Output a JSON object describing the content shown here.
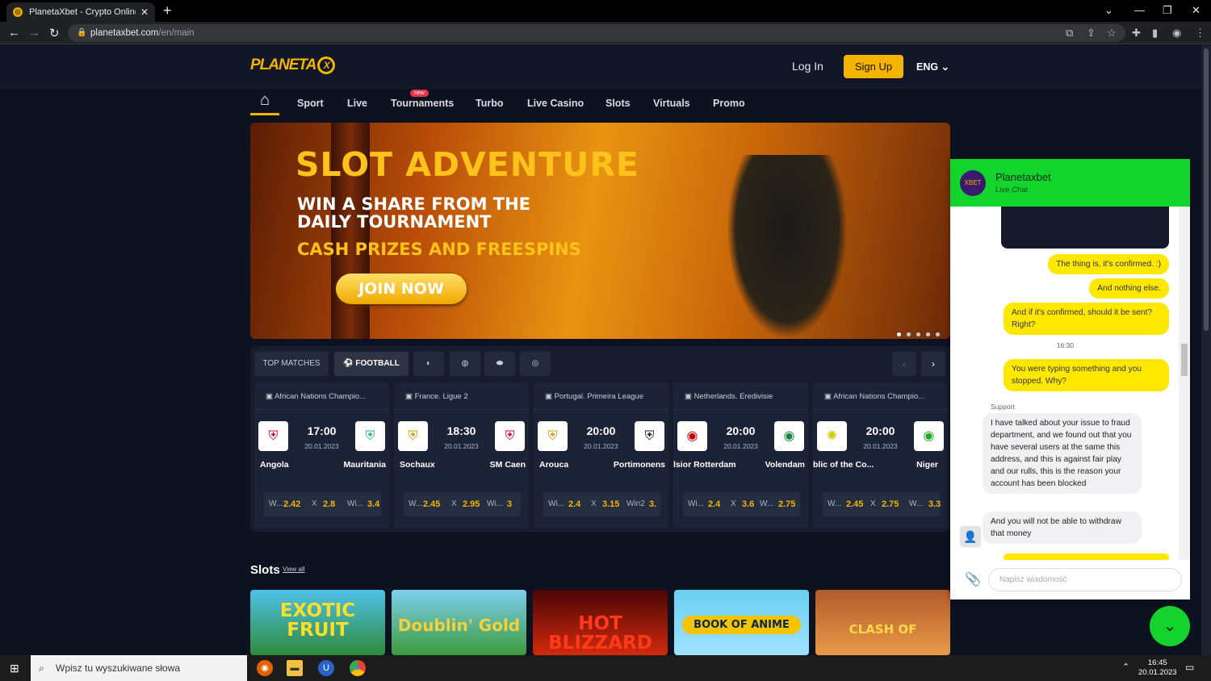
{
  "browser": {
    "tab_title": "PlanetaXbet - Crypto Online Casi",
    "url_host": "planetaxbet.com",
    "url_path": "/en/main"
  },
  "site": {
    "logo": "PLANETA",
    "login": "Log In",
    "signup": "Sign Up",
    "lang": "ENG",
    "nav": [
      "Sport",
      "Live",
      "Tournaments",
      "Turbo",
      "Live Casino",
      "Slots",
      "Virtuals",
      "Promo"
    ],
    "new_badge": "new"
  },
  "banner": {
    "title": "SLOT ADVENTURE",
    "sub1a": "WIN A SHARE FROM THE",
    "sub1b": "DAILY TOURNAMENT",
    "sub2": "CASH PRIZES AND FREESPINS",
    "cta": "JOIN NOW"
  },
  "matches": {
    "top_label": "TOP MATCHES",
    "football_label": "FOOTBALL",
    "cards": [
      {
        "league": "African Nations Champio...",
        "time": "17:00",
        "date": "20.01.2023",
        "home": "Angola",
        "away": "Mauritania",
        "l1": "W...",
        "o1": "2.42",
        "l2": "X",
        "o2": "2.8",
        "l3": "Wi...",
        "o3": "3.4"
      },
      {
        "league": "France. Ligue 2",
        "time": "18:30",
        "date": "20.01.2023",
        "home": "Sochaux",
        "away": "SM Caen",
        "l1": "W...",
        "o1": "2.45",
        "l2": "X",
        "o2": "2.95",
        "l3": "Wi...",
        "o3": "3"
      },
      {
        "league": "Portugal. Primeira League",
        "time": "20:00",
        "date": "20.01.2023",
        "home": "Arouca",
        "away": "Portimonens",
        "l1": "Wi...",
        "o1": "2.4",
        "l2": "X",
        "o2": "3.15",
        "l3": "Win2",
        "o3": "3."
      },
      {
        "league": "Netherlands. Eredivisie",
        "time": "20:00",
        "date": "20.01.2023",
        "home": "lsior Rotterdam",
        "away": "Volendam",
        "l1": "Wi...",
        "o1": "2.4",
        "l2": "X",
        "o2": "3.6",
        "l3": "W...",
        "o3": "2.75"
      },
      {
        "league": "African Nations Champio...",
        "time": "20:00",
        "date": "20.01.2023",
        "home": "blic of the Co...",
        "away": "Niger",
        "l1": "W...",
        "o1": "2.45",
        "l2": "X",
        "o2": "2.75",
        "l3": "W...",
        "o3": "3.3"
      }
    ]
  },
  "slots": {
    "heading": "Slots",
    "view_all": "View all",
    "games": [
      "EXOTIC FRUIT",
      "Doublin' Gold",
      "HOT BLIZZARD",
      "BOOK OF ANIME",
      "CLASH OF"
    ]
  },
  "chat": {
    "name": "Planetaxbet",
    "subtitle": "Live Chat",
    "messages": {
      "m1": "The thing is, it's confirmed. :)",
      "m2": "And nothing else.",
      "m3": "And if it's confirmed, should it be sent? Right?",
      "time": "16:30",
      "m4": "You were typing something and you stopped. Why?",
      "sender": "Support",
      "m5": "I have talked about your issue to fraud department, and we found out that you have several users at the same this address, and this is against fair play and our rulls, this is the reason your account has been blocked",
      "m6": "And you will not be able to withdraw that money"
    },
    "input_placeholder": "Napisz wiadomość"
  },
  "taskbar": {
    "search_placeholder": "Wpisz tu wyszukiwane słowa",
    "time": "16:45",
    "date": "20.01.2023"
  }
}
